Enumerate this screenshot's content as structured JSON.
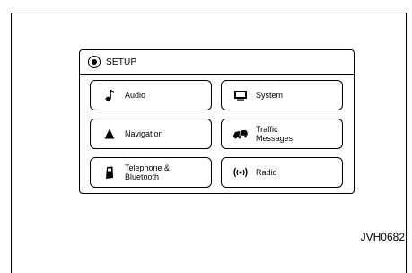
{
  "header": {
    "title": "SETUP",
    "icon": "gear-icon"
  },
  "buttons": {
    "audio": {
      "label": "Audio",
      "icon": "music-note-icon"
    },
    "system": {
      "label": "System",
      "icon": "display-icon"
    },
    "navigation": {
      "label": "Navigation",
      "icon": "navigation-arrow-icon"
    },
    "traffic": {
      "label": "Traffic\nMessages",
      "icon": "traffic-icon"
    },
    "telephone": {
      "label": "Telephone &\nBluetooth",
      "icon": "phone-icon"
    },
    "radio": {
      "label": "Radio",
      "icon": "radio-waves-icon"
    }
  },
  "figure_code": "JVH0682"
}
